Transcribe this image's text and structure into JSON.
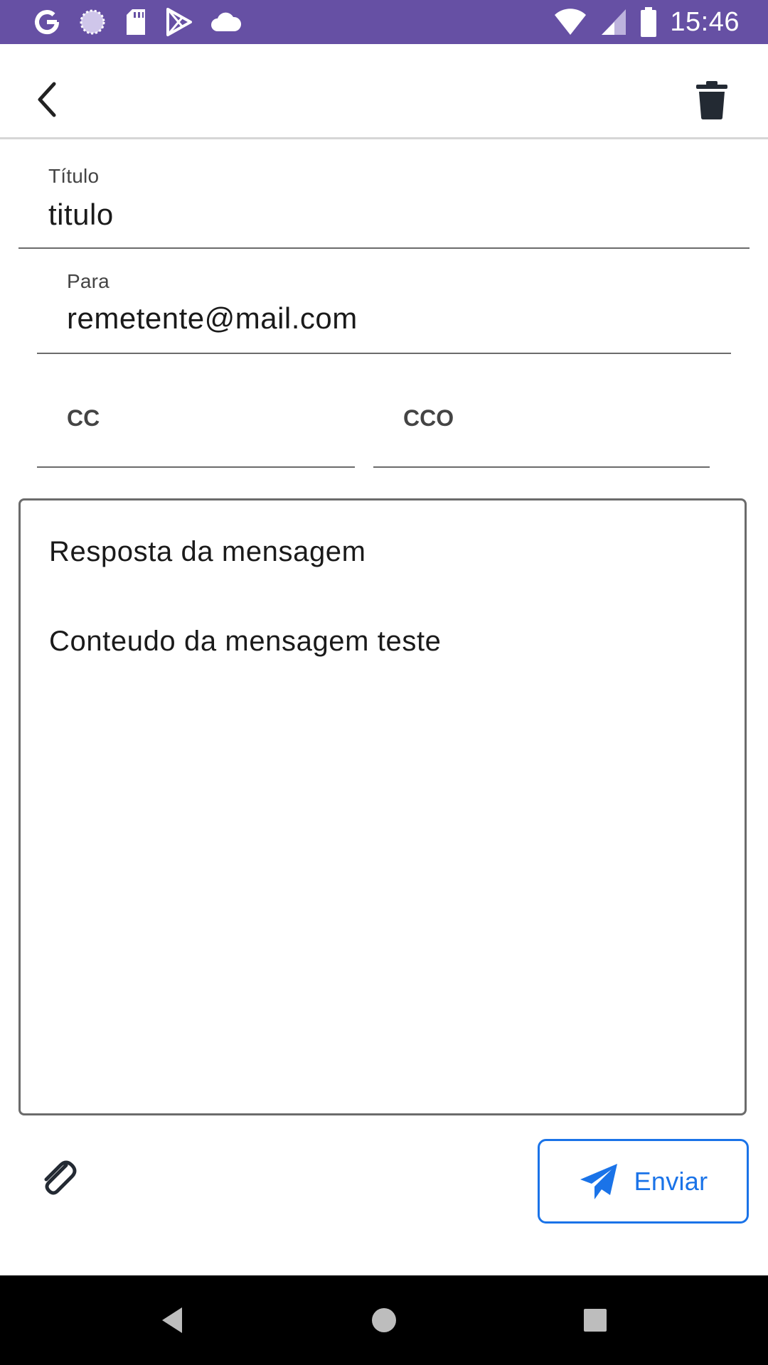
{
  "status_bar": {
    "time": "15:46",
    "left_icons": [
      "google-icon",
      "loading-circle-icon",
      "sd-card-icon",
      "play-store-icon",
      "cloud-icon"
    ],
    "right_icons": [
      "wifi-icon",
      "signal-icon",
      "battery-icon"
    ],
    "background_color": "#6650a4"
  },
  "app_bar": {
    "back_icon": "chevron-left-icon",
    "delete_icon": "trash-icon"
  },
  "form": {
    "title": {
      "label": "Título",
      "value": "titulo"
    },
    "to": {
      "label": "Para",
      "value": "remetente@mail.com"
    },
    "cc": {
      "label": "CC",
      "value": ""
    },
    "bcc": {
      "label": "CCO",
      "value": ""
    },
    "message": {
      "line1": "Resposta da mensagem",
      "line2": "Conteudo da mensagem teste"
    }
  },
  "actions": {
    "attach_icon": "paperclip-icon",
    "send_label": "Enviar",
    "send_icon": "paper-plane-icon",
    "accent_color": "#1a73e8"
  },
  "nav_bar": {
    "icons": [
      "nav-back-icon",
      "nav-home-icon",
      "nav-recents-icon"
    ]
  }
}
